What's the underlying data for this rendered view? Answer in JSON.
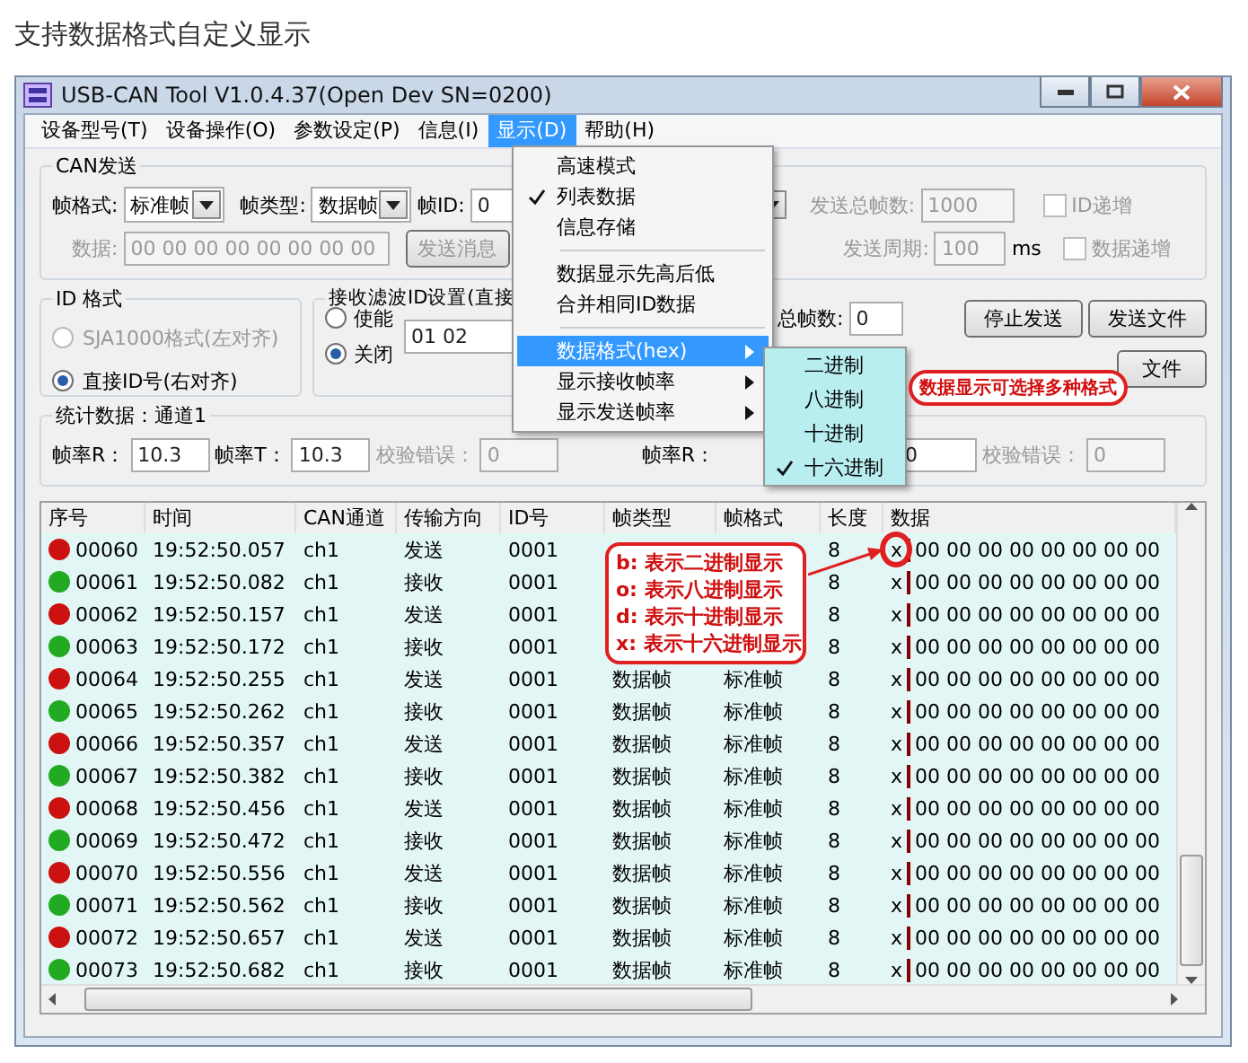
{
  "page_title": "支持数据格式自定义显示",
  "window": {
    "title": "USB-CAN Tool V1.0.4.37(Open Dev SN=0200)"
  },
  "menu": [
    {
      "label": "设备型号(T)",
      "selected": false
    },
    {
      "label": "设备操作(O)",
      "selected": false
    },
    {
      "label": "参数设定(P)",
      "selected": false
    },
    {
      "label": "信息(I)",
      "selected": false
    },
    {
      "label": "显示(D)",
      "selected": true
    },
    {
      "label": "帮助(H)",
      "selected": false
    }
  ],
  "dropdown": [
    {
      "kind": "item",
      "label": "高速模式",
      "checked": false,
      "submenu": false,
      "selected": false
    },
    {
      "kind": "item",
      "label": "列表数据",
      "checked": true,
      "submenu": false,
      "selected": false
    },
    {
      "kind": "item",
      "label": "信息存储",
      "checked": false,
      "submenu": false,
      "selected": false
    },
    {
      "kind": "separator"
    },
    {
      "kind": "item",
      "label": "数据显示先高后低",
      "checked": false,
      "submenu": false,
      "selected": false
    },
    {
      "kind": "item",
      "label": "合并相同ID数据",
      "checked": false,
      "submenu": false,
      "selected": false
    },
    {
      "kind": "separator"
    },
    {
      "kind": "item",
      "label": "数据格式(hex)",
      "checked": false,
      "submenu": true,
      "selected": true
    },
    {
      "kind": "item",
      "label": "显示接收帧率",
      "checked": false,
      "submenu": true,
      "selected": false
    },
    {
      "kind": "item",
      "label": "显示发送帧率",
      "checked": false,
      "submenu": true,
      "selected": false
    }
  ],
  "submenu": [
    {
      "label": "二进制",
      "checked": false
    },
    {
      "label": "八进制",
      "checked": false
    },
    {
      "label": "十进制",
      "checked": false
    },
    {
      "label": "十六进制",
      "checked": true
    }
  ],
  "can_send": {
    "title": "CAN发送",
    "frame_format": {
      "label": "帧格式:",
      "value": "标准帧"
    },
    "frame_type": {
      "label": "帧类型:",
      "value": "数据帧"
    },
    "frame_id": {
      "label": "帧ID:",
      "value": "0"
    },
    "total_frames": {
      "label": "发送总帧数:",
      "value": "1000",
      "disabled": true
    },
    "id_increment": {
      "label": "ID递增",
      "checked": false,
      "disabled": true
    },
    "data": {
      "label": "数据:",
      "value": "00 00 00 00 00 00 00 00",
      "disabled": true
    },
    "send_button": {
      "label": "发送消息",
      "disabled": true
    },
    "period": {
      "label": "发送周期:",
      "value": "100",
      "unit": "ms",
      "disabled": true
    },
    "data_increment": {
      "label": "数据递增",
      "checked": false,
      "disabled": true
    }
  },
  "id_format": {
    "title": "ID 格式",
    "options": [
      {
        "label": "SJA1000格式(左对齐)",
        "selected": false,
        "disabled": true
      },
      {
        "label": "直接ID号(右对齐)",
        "selected": true,
        "disabled": false
      }
    ]
  },
  "filter": {
    "title": "接收滤波ID设置(直接",
    "options": [
      {
        "label": "使能",
        "selected": false
      },
      {
        "label": "关闭",
        "selected": true
      }
    ],
    "value": "01 02"
  },
  "controls": {
    "total_frames": {
      "label": "总帧数:",
      "value": "0"
    },
    "buttons": [
      "停止发送",
      "发送文件"
    ],
    "button_3": "文件"
  },
  "stats": {
    "title": "统计数据：通道1",
    "left": [
      {
        "label": "帧率R：",
        "value": "10.3",
        "disabled": false
      },
      {
        "label": "帧率T：",
        "value": "10.3",
        "disabled": false
      },
      {
        "label": "校验错误：",
        "value": "0",
        "disabled": true
      }
    ],
    "right": [
      {
        "label": "帧率R：",
        "disabled": false
      },
      {
        "value": "0",
        "disabled": false
      },
      {
        "label": "校验错误：",
        "value": "0",
        "disabled": true
      }
    ]
  },
  "table": {
    "columns": [
      "序号",
      "时间",
      "CAN通道",
      "传输方向",
      "ID号",
      "帧类型",
      "帧格式",
      "长度",
      "数据"
    ],
    "rows": [
      {
        "color": "#cc1111",
        "cells": [
          "00060",
          "19:52:50.057",
          "ch1",
          "发送",
          "0001",
          null,
          null,
          "8"
        ],
        "mark": "x",
        "data": "00 00 00 00 00 00 00 00"
      },
      {
        "color": "#22aa22",
        "cells": [
          "00061",
          "19:52:50.082",
          "ch1",
          "接收",
          "0001",
          null,
          null,
          "8"
        ],
        "mark": "x",
        "data": "00 00 00 00 00 00 00 00"
      },
      {
        "color": "#cc1111",
        "cells": [
          "00062",
          "19:52:50.157",
          "ch1",
          "发送",
          "0001",
          null,
          null,
          "8"
        ],
        "mark": "x",
        "data": "00 00 00 00 00 00 00 00"
      },
      {
        "color": "#22aa22",
        "cells": [
          "00063",
          "19:52:50.172",
          "ch1",
          "接收",
          "0001",
          null,
          null,
          "8"
        ],
        "mark": "x",
        "data": "00 00 00 00 00 00 00 00"
      },
      {
        "color": "#cc1111",
        "cells": [
          "00064",
          "19:52:50.255",
          "ch1",
          "发送",
          "0001",
          "数据帧",
          "标准帧",
          "8"
        ],
        "mark": "x",
        "data": "00 00 00 00 00 00 00 00"
      },
      {
        "color": "#22aa22",
        "cells": [
          "00065",
          "19:52:50.262",
          "ch1",
          "接收",
          "0001",
          "数据帧",
          "标准帧",
          "8"
        ],
        "mark": "x",
        "data": "00 00 00 00 00 00 00 00"
      },
      {
        "color": "#cc1111",
        "cells": [
          "00066",
          "19:52:50.357",
          "ch1",
          "发送",
          "0001",
          "数据帧",
          "标准帧",
          "8"
        ],
        "mark": "x",
        "data": "00 00 00 00 00 00 00 00"
      },
      {
        "color": "#22aa22",
        "cells": [
          "00067",
          "19:52:50.382",
          "ch1",
          "接收",
          "0001",
          "数据帧",
          "标准帧",
          "8"
        ],
        "mark": "x",
        "data": "00 00 00 00 00 00 00 00"
      },
      {
        "color": "#cc1111",
        "cells": [
          "00068",
          "19:52:50.456",
          "ch1",
          "发送",
          "0001",
          "数据帧",
          "标准帧",
          "8"
        ],
        "mark": "x",
        "data": "00 00 00 00 00 00 00 00"
      },
      {
        "color": "#22aa22",
        "cells": [
          "00069",
          "19:52:50.472",
          "ch1",
          "接收",
          "0001",
          "数据帧",
          "标准帧",
          "8"
        ],
        "mark": "x",
        "data": "00 00 00 00 00 00 00 00"
      },
      {
        "color": "#cc1111",
        "cells": [
          "00070",
          "19:52:50.556",
          "ch1",
          "发送",
          "0001",
          "数据帧",
          "标准帧",
          "8"
        ],
        "mark": "x",
        "data": "00 00 00 00 00 00 00 00"
      },
      {
        "color": "#22aa22",
        "cells": [
          "00071",
          "19:52:50.562",
          "ch1",
          "接收",
          "0001",
          "数据帧",
          "标准帧",
          "8"
        ],
        "mark": "x",
        "data": "00 00 00 00 00 00 00 00"
      },
      {
        "color": "#cc1111",
        "cells": [
          "00072",
          "19:52:50.657",
          "ch1",
          "发送",
          "0001",
          "数据帧",
          "标准帧",
          "8"
        ],
        "mark": "x",
        "data": "00 00 00 00 00 00 00 00"
      },
      {
        "color": "#22aa22",
        "cells": [
          "00073",
          "19:52:50.682",
          "ch1",
          "接收",
          "0001",
          "数据帧",
          "标准帧",
          "8"
        ],
        "mark": "x",
        "data": "00 00 00 00 00 00 00 00"
      }
    ]
  },
  "callouts": {
    "menu_note": "数据显示可选择多种格式",
    "legend": [
      "b: 表示二进制显示",
      "o: 表示八进制显示",
      "d: 表示十进制显示",
      "x: 表示十六进制显示"
    ]
  }
}
